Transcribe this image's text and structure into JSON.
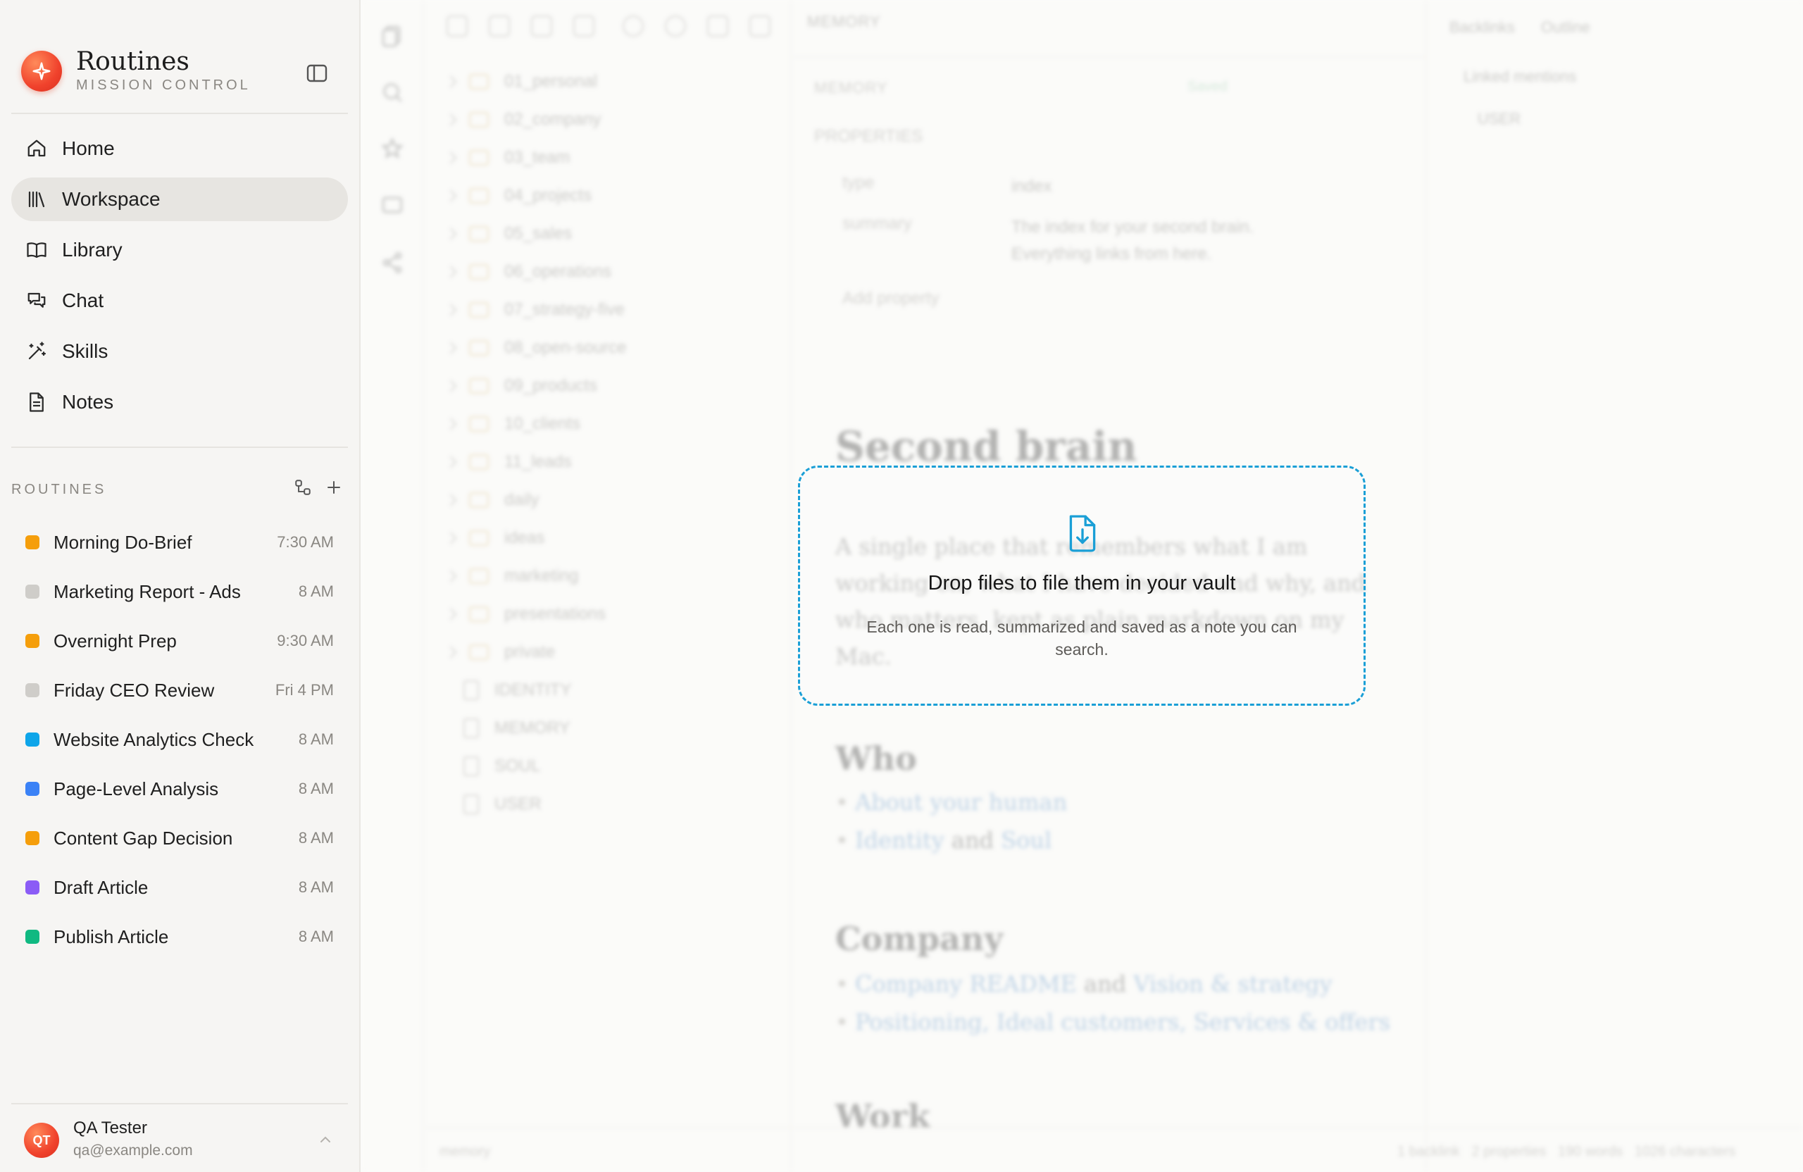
{
  "brand": {
    "title": "Routines",
    "subtitle": "MISSION CONTROL"
  },
  "nav": {
    "items": [
      {
        "label": "Home",
        "icon": "home-icon"
      },
      {
        "label": "Workspace",
        "icon": "library-icon",
        "active": true
      },
      {
        "label": "Library",
        "icon": "book-icon"
      },
      {
        "label": "Chat",
        "icon": "chat-icon"
      },
      {
        "label": "Skills",
        "icon": "wand-icon"
      },
      {
        "label": "Notes",
        "icon": "notes-icon"
      }
    ]
  },
  "routines": {
    "header": "ROUTINES",
    "items": [
      {
        "name": "Morning Do-Brief",
        "time": "7:30 AM",
        "color": "#f59e0b"
      },
      {
        "name": "Marketing Report - Ads",
        "time": "8 AM",
        "color": "#cfcdc9"
      },
      {
        "name": "Overnight Prep",
        "time": "9:30 AM",
        "color": "#f59e0b"
      },
      {
        "name": "Friday CEO Review",
        "time": "Fri 4 PM",
        "color": "#cfcdc9"
      },
      {
        "name": "Website Analytics Check",
        "time": "8 AM",
        "color": "#0ea5e9"
      },
      {
        "name": "Page-Level Analysis",
        "time": "8 AM",
        "color": "#3b82f6"
      },
      {
        "name": "Content Gap Decision",
        "time": "8 AM",
        "color": "#f59e0b"
      },
      {
        "name": "Draft Article",
        "time": "8 AM",
        "color": "#8b5cf6"
      },
      {
        "name": "Publish Article",
        "time": "8 AM",
        "color": "#10b981"
      }
    ]
  },
  "user": {
    "initials": "QT",
    "name": "QA Tester",
    "email": "qa@example.com"
  },
  "tree": {
    "folders": [
      "01_personal",
      "02_company",
      "03_team",
      "04_projects",
      "05_sales",
      "06_operations",
      "07_strategy-five",
      "08_open-source",
      "09_products",
      "10_clients",
      "11_leads",
      "daily",
      "ideas",
      "marketing",
      "presentations",
      "private"
    ],
    "files": [
      "IDENTITY",
      "MEMORY",
      "SOUL",
      "USER"
    ]
  },
  "editor": {
    "tab": "MEMORY",
    "breadcrumb": "MEMORY",
    "saved": "Saved",
    "properties_label": "PROPERTIES",
    "props": [
      {
        "key": "type",
        "value": "index"
      },
      {
        "key": "summary",
        "value": "The index for your second brain. Everything links from here."
      }
    ],
    "add_property": "Add property",
    "doc_title": "Second brain",
    "doc_intro": "A single place that remembers what I am working on, what I have decided and why, and who matters, kept as plain markdown on my Mac.",
    "who_heading": "Who",
    "who_link1": "About your human",
    "who_link2a": "Identity",
    "who_and": "and",
    "who_link2b": "Soul",
    "company_heading": "Company",
    "company_link1a": "Company README",
    "company_and": "and",
    "company_link1b": "Vision & strategy",
    "company_link2": "Positioning, Ideal customers, Services & offers",
    "work_heading": "Work"
  },
  "backlinks": {
    "tab1": "Backlinks",
    "tab2": "Outline",
    "linked": "Linked mentions",
    "item": "USER"
  },
  "statusbar": {
    "name": "memory",
    "stats": "1 backlink   2 properties   190 words   1026 characters"
  },
  "dropzone": {
    "title": "Drop files to file them in your vault",
    "subtitle": "Each one is read, summarized and saved as a note you can search.",
    "accent": "#1a9fd6"
  }
}
